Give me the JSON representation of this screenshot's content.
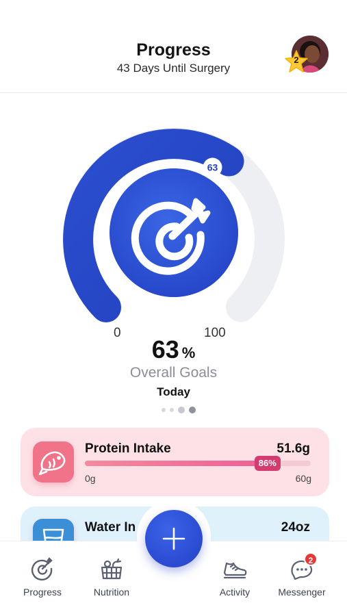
{
  "header": {
    "title": "Progress",
    "subtitle": "43 Days Until Surgery",
    "star_count": "2"
  },
  "gauge": {
    "value": 63,
    "value_badge": "63",
    "min_label": "0",
    "max_label": "100",
    "percent": "63",
    "percent_symbol": "%",
    "caption": "Overall Goals",
    "period": "Today",
    "pager_count": 4,
    "pager_active": 3
  },
  "cards": {
    "protein": {
      "name": "Protein Intake",
      "amount": "51.6g",
      "progress": 0.86,
      "badge": "86%",
      "min": "0g",
      "max": "60g"
    },
    "water": {
      "name": "Water In",
      "amount": "24oz"
    }
  },
  "tabbar": {
    "progress": "Progress",
    "nutrition": "Nutrition",
    "activity": "Activity",
    "messenger": "Messenger",
    "messenger_badge": "2"
  },
  "colors": {
    "accent": "#2845c8",
    "gauge_track": "#eeeff2",
    "protein_bg": "#fde1e6",
    "water_bg": "#dff1fb"
  }
}
